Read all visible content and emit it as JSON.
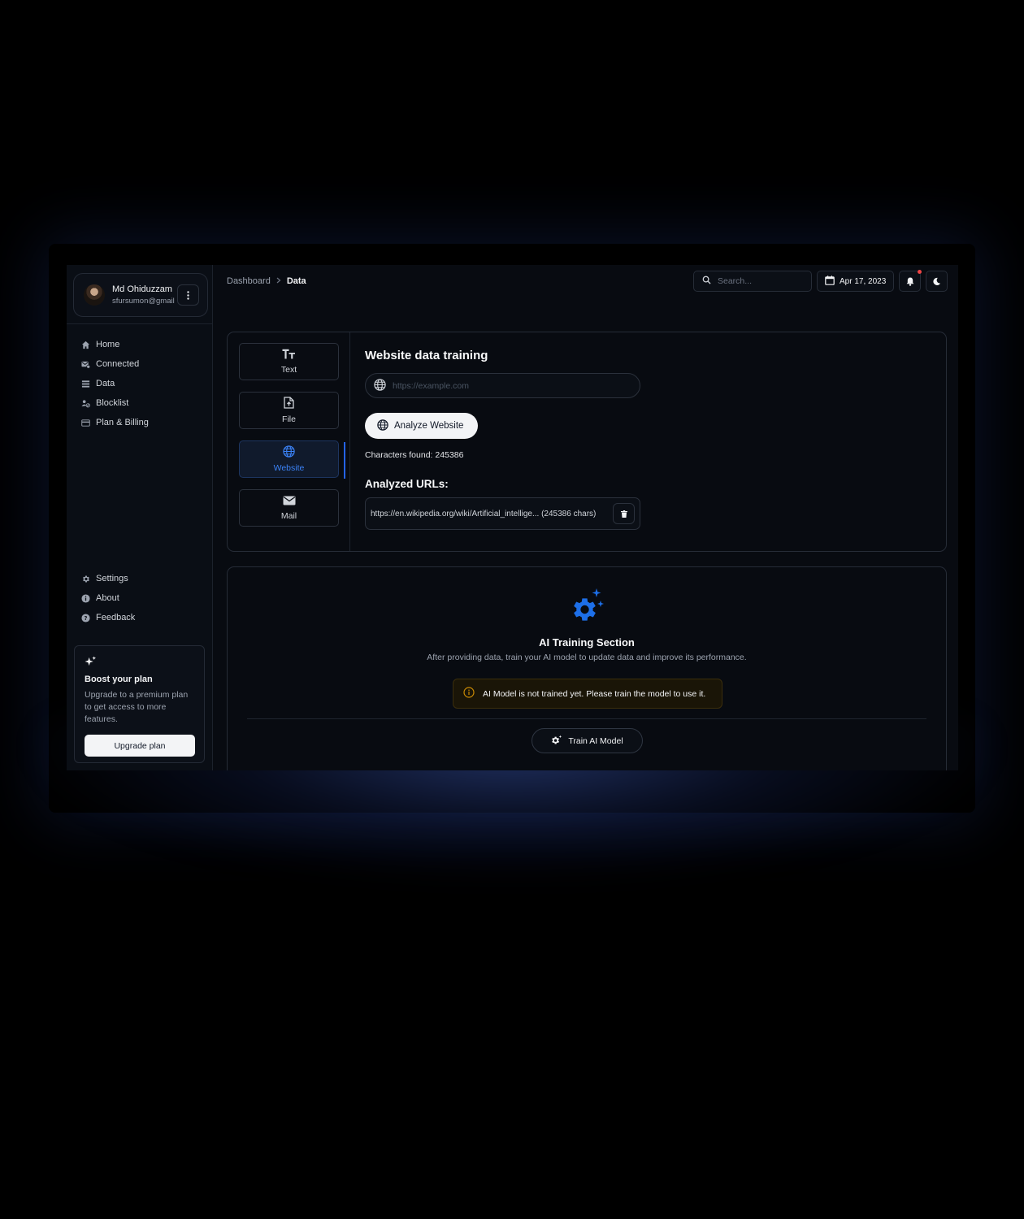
{
  "user": {
    "name": "Md Ohiduzzam",
    "email": "sfursumon@gmail"
  },
  "nav_top": [
    {
      "label": "Home",
      "icon": "home-icon"
    },
    {
      "label": "Connected",
      "icon": "connected-icon"
    },
    {
      "label": "Data",
      "icon": "data-icon"
    },
    {
      "label": "Blocklist",
      "icon": "blocklist-icon"
    },
    {
      "label": "Plan & Billing",
      "icon": "billing-icon"
    }
  ],
  "nav_bottom": [
    {
      "label": "Settings",
      "icon": "gear-icon"
    },
    {
      "label": "About",
      "icon": "info-icon"
    },
    {
      "label": "Feedback",
      "icon": "help-icon"
    }
  ],
  "boost": {
    "title": "Boost your plan",
    "description": "Upgrade to a premium plan to get access to more features.",
    "button": "Upgrade plan"
  },
  "breadcrumb": {
    "parent": "Dashboard",
    "current": "Data"
  },
  "header": {
    "search_placeholder": "Search...",
    "date": "Apr 17, 2023"
  },
  "data_tabs": [
    {
      "label": "Text",
      "icon": "text-icon",
      "active": false
    },
    {
      "label": "File",
      "icon": "file-upload-icon",
      "active": false
    },
    {
      "label": "Website",
      "icon": "globe-icon",
      "active": true
    },
    {
      "label": "Mail",
      "icon": "mail-icon",
      "active": false
    }
  ],
  "website_training": {
    "title": "Website data training",
    "url_placeholder": "https://example.com",
    "analyze_button": "Analyze Website",
    "characters_found": "Characters found: 245386",
    "analyzed_title": "Analyzed URLs:",
    "analyzed_urls": [
      {
        "text": "https://en.wikipedia.org/wiki/Artificial_intellige... (245386 chars)"
      }
    ]
  },
  "ai_training": {
    "title": "AI Training Section",
    "description": "After providing data, train your AI model to update data and improve its performance.",
    "warning": "AI Model is not trained yet. Please train the model to use it.",
    "train_button": "Train AI Model"
  },
  "colors": {
    "accent": "#3b82f6",
    "background": "#080b11",
    "warning": "#ca8a04",
    "notification": "#ef4444"
  }
}
